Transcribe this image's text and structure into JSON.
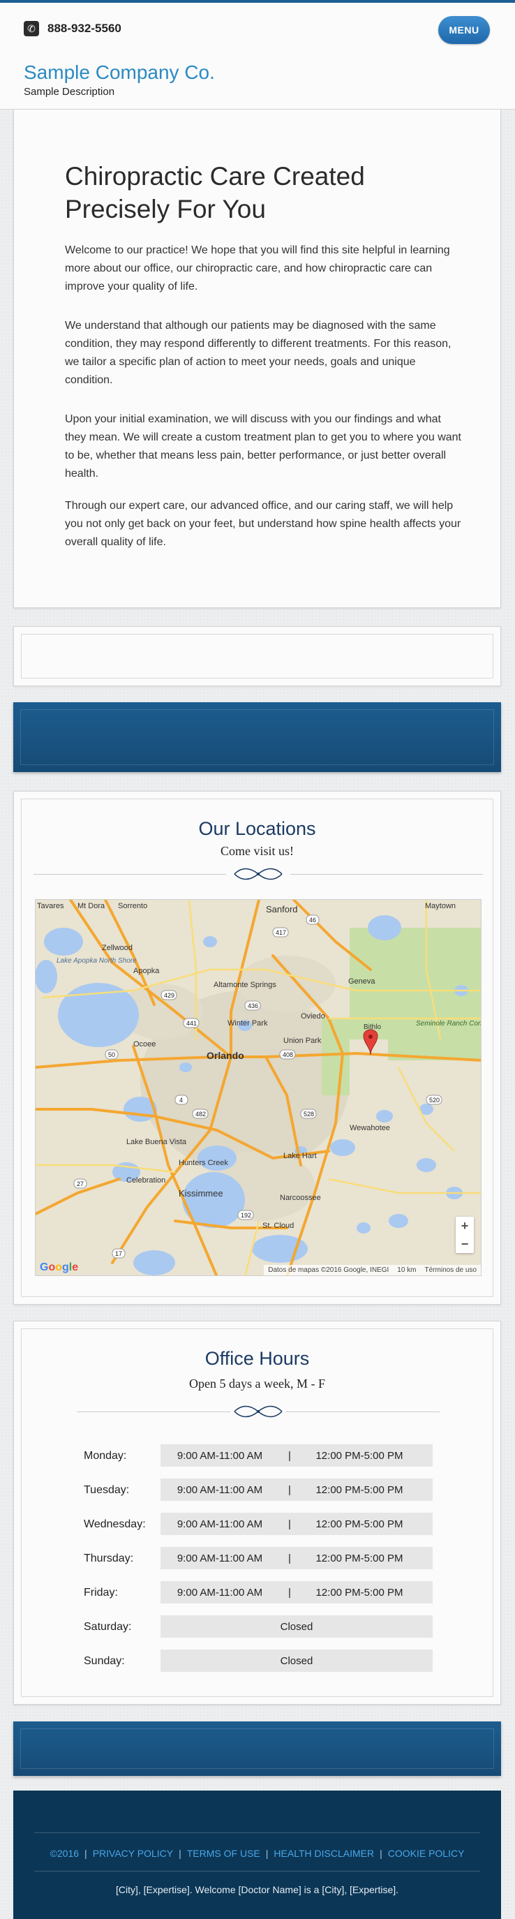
{
  "header": {
    "phone": "888-932-5560",
    "menu_label": "MENU",
    "company_name": "Sample Company Co.",
    "description": "Sample Description"
  },
  "intro": {
    "title": "Chiropractic Care Created Precisely For You",
    "paragraphs": [
      "Welcome to our practice! We hope that you will find this site helpful in learning more about our office, our chiropractic care, and how chiropractic care can improve your quality of life.",
      "We understand that although our patients may be diagnosed with the same condition, they may respond differently to different treatments. For this reason, we tailor a specific plan of action to meet your needs, goals and unique condition.",
      "Upon your initial examination, we will discuss with you our findings and what they mean. We will create a custom treatment plan to get you to where you want to be, whether that means less pain, better performance, or just better overall health.",
      "Through our expert care, our advanced office, and our caring staff, we will help you not only get back on your feet, but understand how spine health affects your overall quality of life."
    ]
  },
  "locations": {
    "title": "Our Locations",
    "subtitle": "Come visit us!",
    "map": {
      "place_labels": [
        "Tavares",
        "Mt Dora",
        "Sorrento",
        "Sanford",
        "Maytown",
        "Zellwood",
        "Apopka",
        "Lake Apopka North Shore",
        "Altamonte Springs",
        "Oviedo",
        "Geneva",
        "Winter Park",
        "Orlando",
        "Union Park",
        "Seminole Ranch Conservation Area",
        "Ocoee",
        "Wewahotee",
        "Lake Buena Vista",
        "Hunters Creek",
        "Lake Hart",
        "Celebration",
        "Kissimmee",
        "Narcoossee",
        "St. Cloud",
        "Bithlo"
      ],
      "road_labels": [
        "441",
        "46",
        "417",
        "429",
        "408",
        "4",
        "50",
        "520",
        "528",
        "192",
        "27",
        "17",
        "436",
        "482"
      ],
      "zoom_in": "+",
      "zoom_out": "−",
      "google": "Google",
      "attribution": "Datos de mapas ©2016 Google, INEGI",
      "scale": "10 km",
      "terms": "Términos de uso"
    }
  },
  "hours": {
    "title": "Office Hours",
    "subtitle": "Open 5 days a week, M - F",
    "separator": "|",
    "rows": [
      {
        "day": "Monday:",
        "am": "9:00 AM-11:00 AM",
        "pm": "12:00 PM-5:00 PM"
      },
      {
        "day": "Tuesday:",
        "am": "9:00 AM-11:00 AM",
        "pm": "12:00 PM-5:00 PM"
      },
      {
        "day": "Wednesday:",
        "am": "9:00 AM-11:00 AM",
        "pm": "12:00 PM-5:00 PM"
      },
      {
        "day": "Thursday:",
        "am": "9:00 AM-11:00 AM",
        "pm": "12:00 PM-5:00 PM"
      },
      {
        "day": "Friday:",
        "am": "9:00 AM-11:00 AM",
        "pm": "12:00 PM-5:00 PM"
      },
      {
        "day": "Saturday:",
        "closed": "Closed"
      },
      {
        "day": "Sunday:",
        "closed": "Closed"
      }
    ]
  },
  "footer": {
    "copyright": "©2016",
    "links": [
      "PRIVACY POLICY",
      "TERMS OF USE",
      "HEALTH DISCLAIMER",
      "COOKIE POLICY"
    ],
    "separator": "|",
    "note": "[City], [Expertise]. Welcome [Doctor Name] is a [City], [Expertise]."
  },
  "colors": {
    "accent": "#2b8ac2",
    "banner": "#1a5482",
    "footer": "#0b3656",
    "title": "#1b3a63"
  }
}
